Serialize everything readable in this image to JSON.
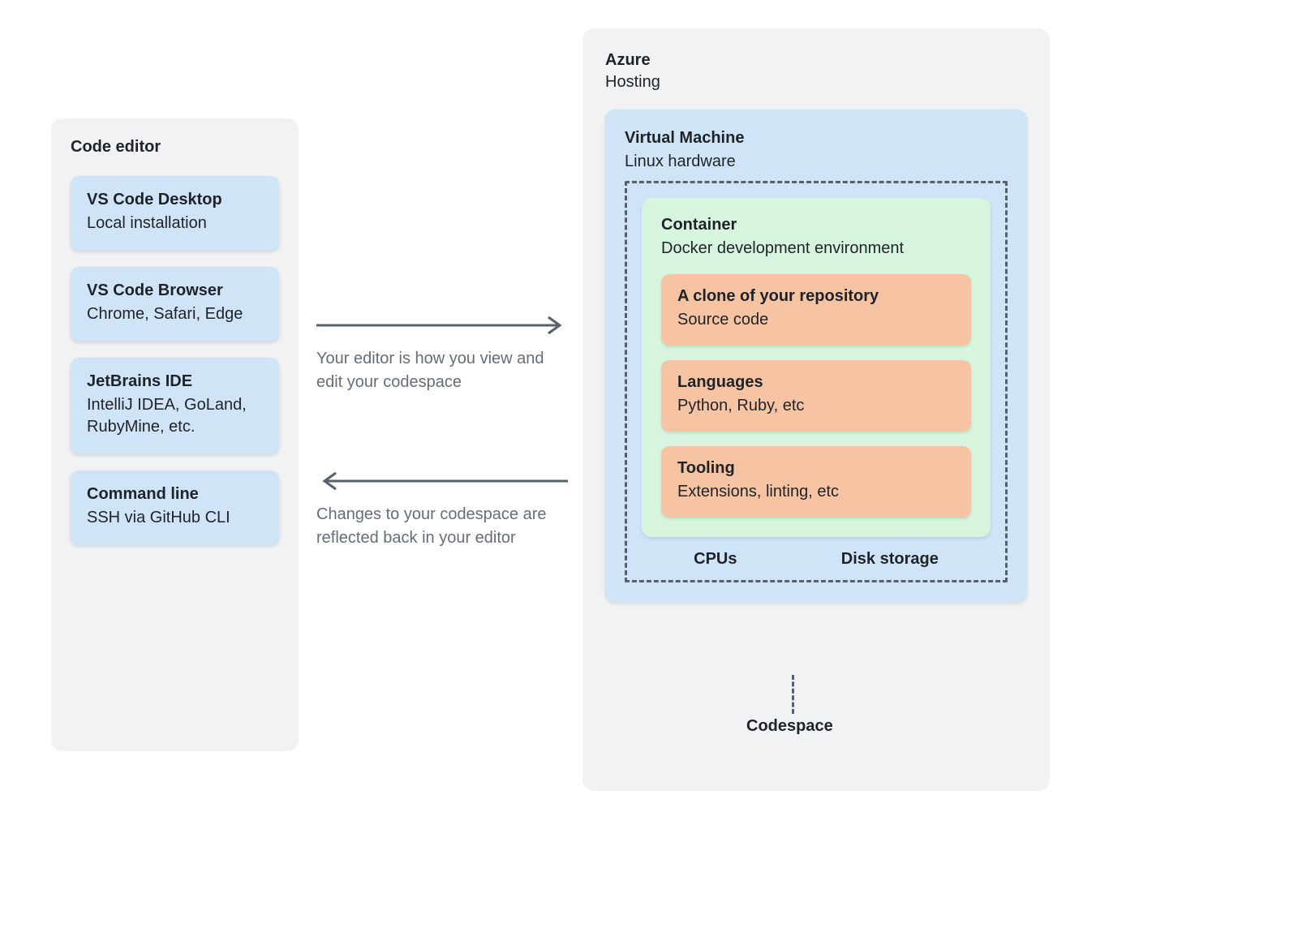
{
  "left": {
    "title": "Code editor",
    "cards": [
      {
        "title": "VS Code Desktop",
        "sub": "Local installation"
      },
      {
        "title": "VS Code Browser",
        "sub": "Chrome, Safari, Edge"
      },
      {
        "title": "JetBrains IDE",
        "sub": "IntelliJ IDEA, GoLand, RubyMine, etc."
      },
      {
        "title": "Command line",
        "sub": "SSH via GitHub CLI"
      }
    ]
  },
  "arrows": {
    "to_cloud": "Your editor is how you view and edit your codespace",
    "from_cloud": "Changes to your codespace are reflected back in your editor"
  },
  "right": {
    "title": "Azure",
    "subtitle": "Hosting",
    "vm": {
      "title": "Virtual Machine",
      "subtitle": "Linux hardware",
      "container": {
        "title": "Container",
        "subtitle": "Docker development environment",
        "items": [
          {
            "title": "A clone of your repository",
            "sub": "Source code"
          },
          {
            "title": "Languages",
            "sub": "Python, Ruby, etc"
          },
          {
            "title": "Tooling",
            "sub": "Extensions, linting, etc"
          }
        ]
      },
      "resources": {
        "cpu": "CPUs",
        "disk": "Disk storage"
      }
    },
    "codespace_label": "Codespace"
  }
}
